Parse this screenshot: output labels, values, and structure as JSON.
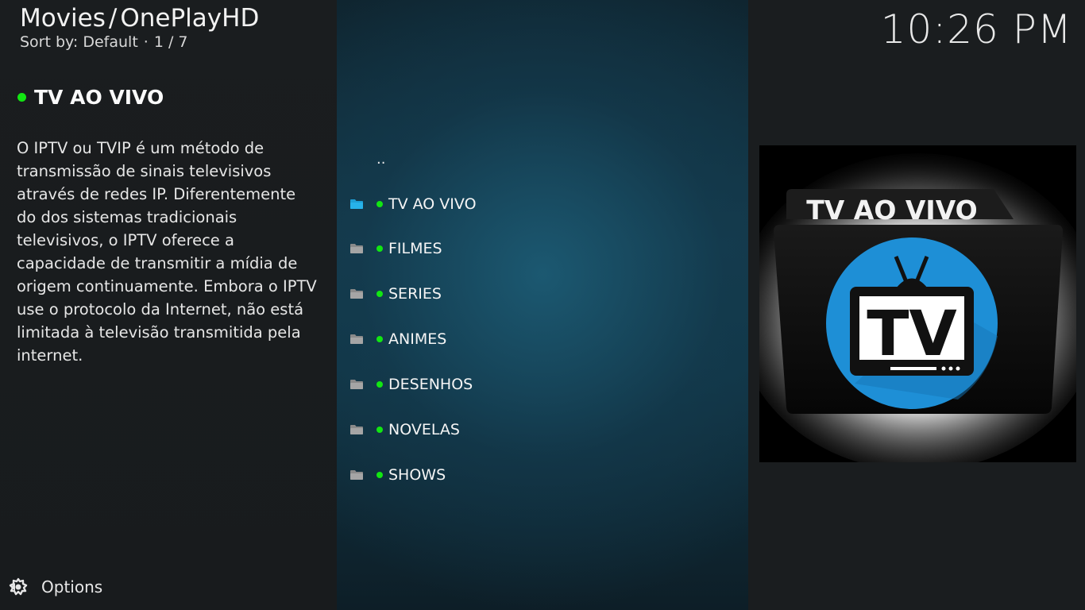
{
  "header": {
    "section": "Movies",
    "separator": "/",
    "addon": "OnePlayHD",
    "sort_label": "Sort by: Default",
    "dot": "·",
    "position": "1 / 7"
  },
  "clock": "10:26 PM",
  "info": {
    "title": "TV AO VIVO",
    "plot": "O IPTV ou TVIP é um método de transmissão de sinais televisivos através de redes IP. Diferentemente do dos sistemas tradicionais televisivos, o IPTV oferece a capacidade de transmitir a mídia de origem continuamente. Embora o IPTV use o protocolo da Internet, não está limitada à televisão transmitida pela internet."
  },
  "options_label": "Options",
  "list": {
    "parent": "..",
    "items": [
      {
        "label": "TV AO VIVO",
        "selected": true
      },
      {
        "label": "FILMES",
        "selected": false
      },
      {
        "label": "SERIES",
        "selected": false
      },
      {
        "label": "ANIMES",
        "selected": false
      },
      {
        "label": "DESENHOS",
        "selected": false
      },
      {
        "label": "NOVELAS",
        "selected": false
      },
      {
        "label": "SHOWS",
        "selected": false
      }
    ]
  },
  "poster": {
    "tab_text": "TV AO VIVO",
    "screen_text": "TV"
  },
  "colors": {
    "accent_dot": "#12e612",
    "folder_selected": "#1e9fd6",
    "folder_normal": "#9a9a9a"
  },
  "icons": {
    "options": "options-gear-icon",
    "folder": "folder-icon"
  }
}
